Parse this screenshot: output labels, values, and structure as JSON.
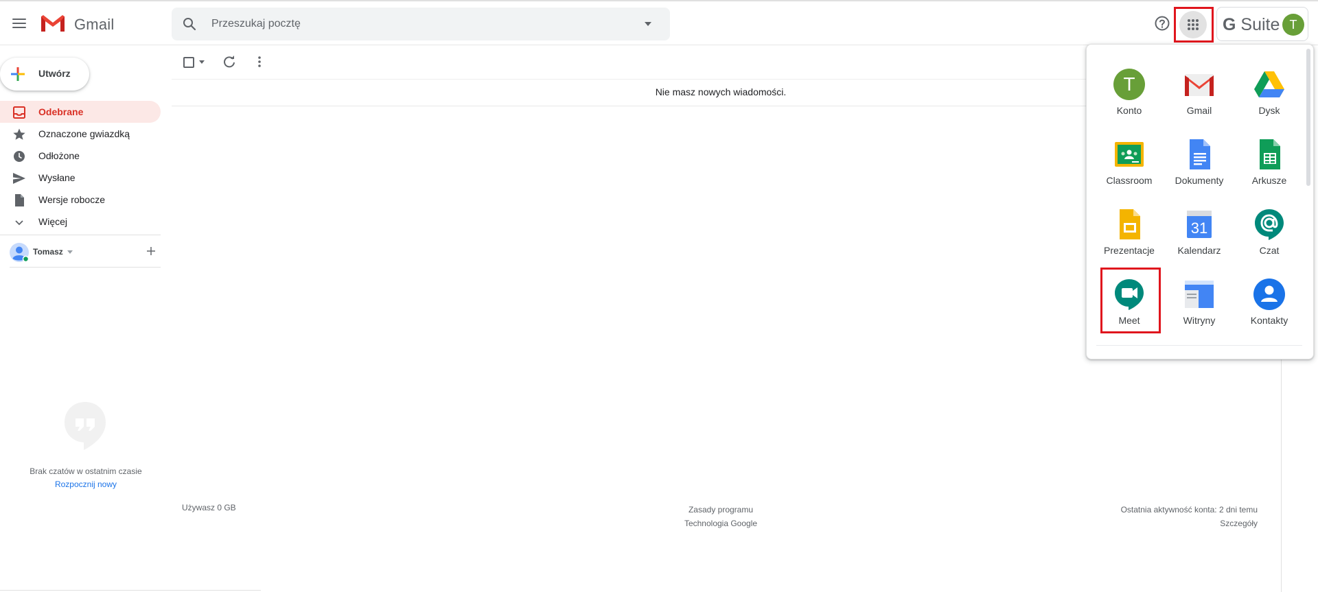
{
  "header": {
    "app_name": "Gmail",
    "search_placeholder": "Przeszukaj pocztę",
    "gsuite_label": "Suite",
    "gsuite_g": "G",
    "avatar_initial": "T"
  },
  "compose": {
    "label": "Utwórz"
  },
  "nav": {
    "items": [
      {
        "label": "Odebrane",
        "icon": "inbox-icon",
        "active": true
      },
      {
        "label": "Oznaczone gwiazdką",
        "icon": "star-icon"
      },
      {
        "label": "Odłożone",
        "icon": "clock-icon"
      },
      {
        "label": "Wysłane",
        "icon": "send-icon"
      },
      {
        "label": "Wersje robocze",
        "icon": "draft-icon"
      },
      {
        "label": "Więcej",
        "icon": "chevron-down-icon"
      }
    ]
  },
  "hangouts": {
    "user_name": "Tomasz",
    "empty_text": "Brak czatów w ostatnim czasie",
    "start_new": "Rozpocznij nowy"
  },
  "main": {
    "empty_message": "Nie masz nowych wiadomości."
  },
  "footer": {
    "storage": "Używasz 0 GB",
    "policy": "Zasady programu",
    "powered": "Technologia Google",
    "activity": "Ostatnia aktywność konta: 2 dni temu",
    "details": "Szczegóły"
  },
  "apps": [
    {
      "label": "Konto",
      "icon": "account-icon",
      "initial": "T"
    },
    {
      "label": "Gmail",
      "icon": "gmail-icon"
    },
    {
      "label": "Dysk",
      "icon": "drive-icon"
    },
    {
      "label": "Classroom",
      "icon": "classroom-icon"
    },
    {
      "label": "Dokumenty",
      "icon": "docs-icon"
    },
    {
      "label": "Arkusze",
      "icon": "sheets-icon"
    },
    {
      "label": "Prezentacje",
      "icon": "slides-icon"
    },
    {
      "label": "Kalendarz",
      "icon": "calendar-icon",
      "day": "31"
    },
    {
      "label": "Czat",
      "icon": "chat-icon"
    },
    {
      "label": "Meet",
      "icon": "meet-icon"
    },
    {
      "label": "Witryny",
      "icon": "sites-icon"
    },
    {
      "label": "Kontakty",
      "icon": "contacts-icon"
    }
  ],
  "colors": {
    "accent_red": "#d93025",
    "highlight_red": "#e0151d",
    "link_blue": "#1a73e8",
    "avatar_green": "#689f38"
  }
}
